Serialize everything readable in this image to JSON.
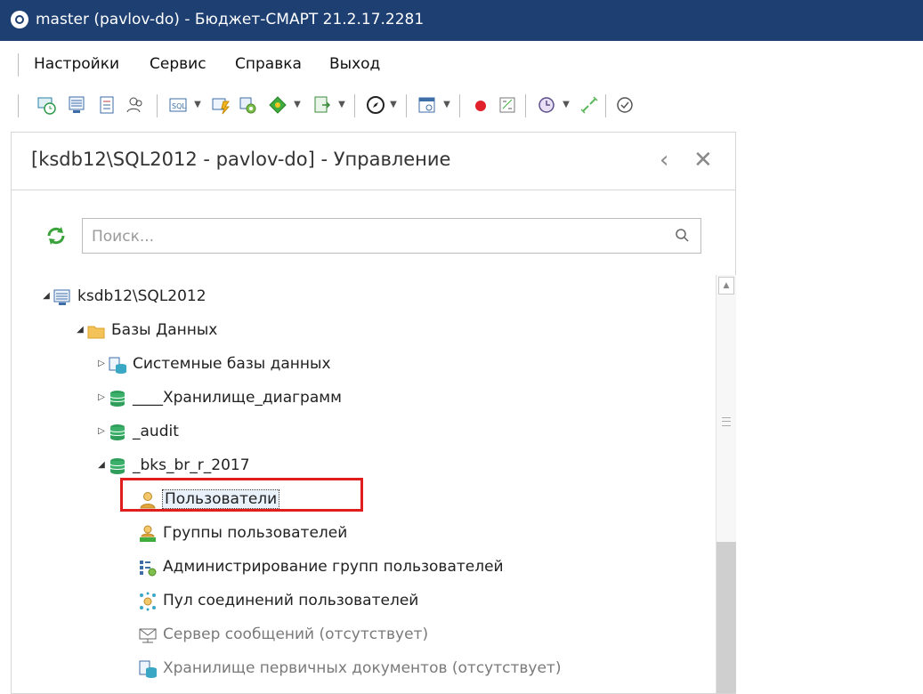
{
  "window": {
    "title": "master (pavlov-do) - Бюджет-СМАРТ 21.2.17.2281"
  },
  "menu": {
    "items": [
      "Настройки",
      "Сервис",
      "Справка",
      "Выход"
    ]
  },
  "toolbar": {
    "icons": [
      "monitor-clock-icon",
      "server-list-icon",
      "document-list-icon",
      "users-icon",
      "sql-icon",
      "sql-run-icon",
      "user-gear-icon",
      "diamond-icon",
      "export-icon",
      "compass-icon",
      "report-icon",
      "record-icon",
      "compare-icon",
      "clock-icon",
      "unlink-icon",
      "check-icon"
    ]
  },
  "panel": {
    "title": "[ksdb12\\SQL2012 - pavlov-do] - Управление",
    "search": {
      "placeholder": "Поиск...",
      "value": ""
    }
  },
  "tree": {
    "nodes": [
      {
        "label": "ksdb12\\SQL2012",
        "level": 0,
        "state": "expanded",
        "icon": "server-icon"
      },
      {
        "label": "Базы Данных",
        "level": 1,
        "state": "expanded",
        "icon": "folder-icon"
      },
      {
        "label": "Системные базы данных",
        "level": 2,
        "state": "collapsed",
        "icon": "system-databases-icon"
      },
      {
        "label": "____Хранилище_диаграмм",
        "level": 2,
        "state": "collapsed",
        "icon": "database-icon"
      },
      {
        "label": "_audit",
        "level": 2,
        "state": "collapsed",
        "icon": "database-icon"
      },
      {
        "label": "_bks_br_r_2017",
        "level": 2,
        "state": "expanded",
        "icon": "database-icon"
      },
      {
        "label": "Пользователи",
        "level": 3,
        "state": "leaf",
        "icon": "user-icon",
        "selected": true
      },
      {
        "label": "Группы пользователей",
        "level": 3,
        "state": "leaf",
        "icon": "user-group-icon"
      },
      {
        "label": "Администрирование групп пользователей",
        "level": 3,
        "state": "leaf",
        "icon": "group-admin-icon"
      },
      {
        "label": "Пул соединений пользователей",
        "level": 3,
        "state": "leaf",
        "icon": "connection-pool-icon"
      },
      {
        "label": "Сервер сообщений (отсутствует)",
        "level": 3,
        "state": "leaf",
        "icon": "mail-server-icon",
        "dim": true
      },
      {
        "label": "Хранилище первичных документов (отсутствует)",
        "level": 3,
        "state": "leaf",
        "icon": "document-storage-icon",
        "dim": true
      }
    ]
  }
}
